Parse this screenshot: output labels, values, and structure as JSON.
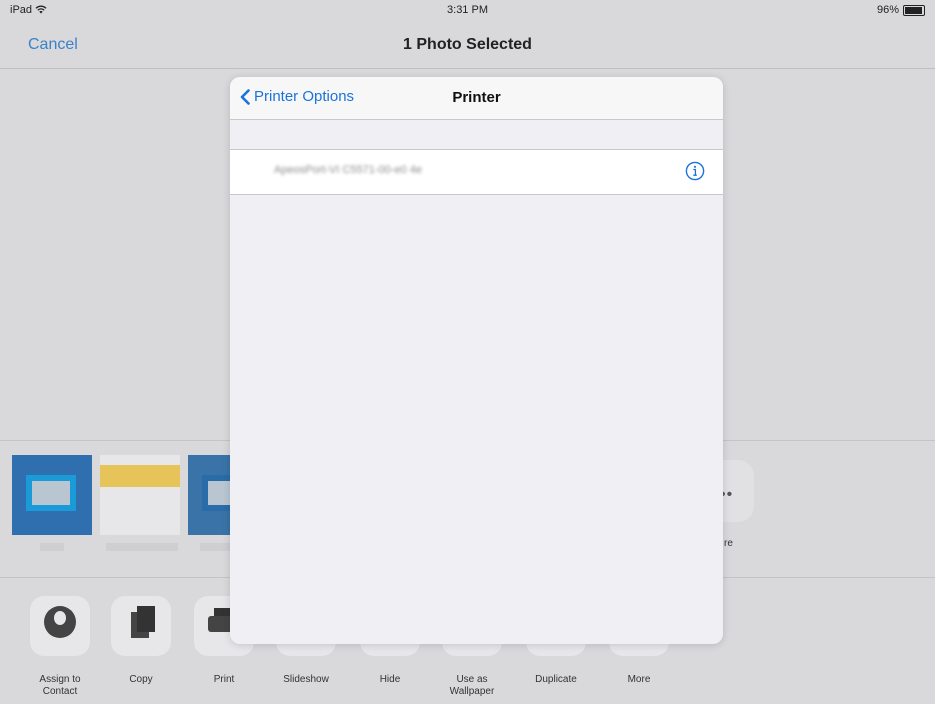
{
  "status_bar": {
    "device": "iPad",
    "time": "3:31 PM",
    "battery": "96%",
    "battery_level": 0.96
  },
  "navbar": {
    "cancel_label": "Cancel",
    "title": "1 Photo Selected"
  },
  "modal": {
    "back_label": "Printer Options",
    "title": "Printer",
    "printers": [
      {
        "name": "ApeosPort-VI C5571-00-e0 4e"
      }
    ]
  },
  "share_row": {
    "more_label": "re"
  },
  "actions": [
    {
      "label": "Assign to Contact",
      "icon": "contact-icon"
    },
    {
      "label": "Copy",
      "icon": "copy-icon"
    },
    {
      "label": "Print",
      "icon": "print-icon"
    },
    {
      "label": "Slideshow",
      "icon": "slideshow-icon"
    },
    {
      "label": "Hide",
      "icon": "hide-icon"
    },
    {
      "label": "Use as Wallpaper",
      "icon": "wallpaper-icon"
    },
    {
      "label": "Duplicate",
      "icon": "duplicate-icon"
    },
    {
      "label": "More",
      "icon": "more-icon"
    }
  ],
  "colors": {
    "accent": "#1a73d9",
    "background": "#d9d9db",
    "sheet": "#efeff4"
  }
}
